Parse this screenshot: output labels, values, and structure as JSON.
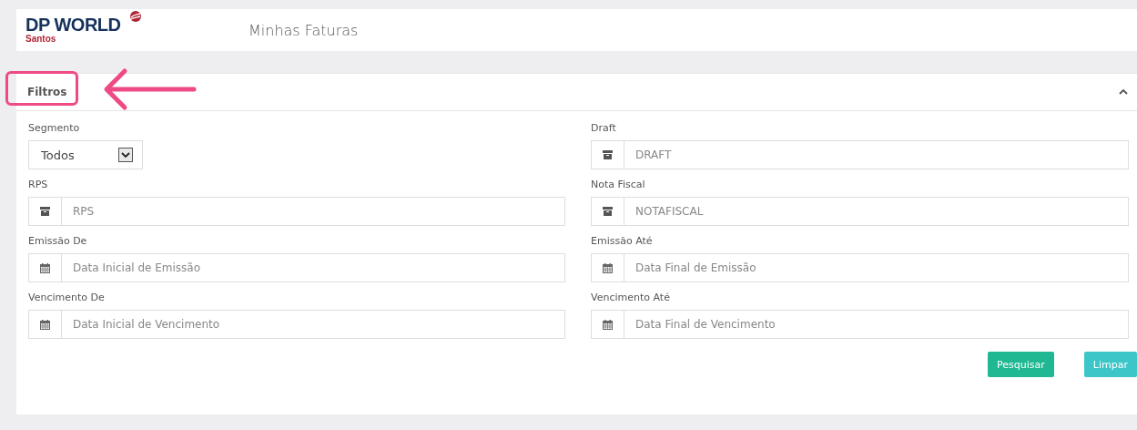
{
  "header": {
    "logo": "DP WORLD",
    "logo_sub": "Santos",
    "title": "Minhas Faturas"
  },
  "panel": {
    "title": "Filtros",
    "expanded": true
  },
  "fields": [
    {
      "label": "Segmento",
      "kind": "select",
      "value": "Todos"
    },
    {
      "label": "Draft",
      "kind": "archive",
      "placeholder": "DRAFT"
    },
    {
      "label": "RPS",
      "kind": "archive",
      "placeholder": "RPS"
    },
    {
      "label": "Nota Fiscal",
      "kind": "archive",
      "placeholder": "NOTAFISCAL"
    },
    {
      "label": "Emissão De",
      "kind": "date",
      "placeholder": "Data Inicial de Emissão"
    },
    {
      "label": "Emissão Até",
      "kind": "date",
      "placeholder": "Data Final de Emissão"
    },
    {
      "label": "Vencimento De",
      "kind": "date",
      "placeholder": "Data Inicial de Vencimento"
    },
    {
      "label": "Vencimento Até",
      "kind": "date",
      "placeholder": "Data Final de Vencimento"
    }
  ],
  "buttons": [
    {
      "label": "Pesquisar",
      "kind": "primary"
    },
    {
      "label": "Limpar",
      "kind": "secondary"
    }
  ]
}
